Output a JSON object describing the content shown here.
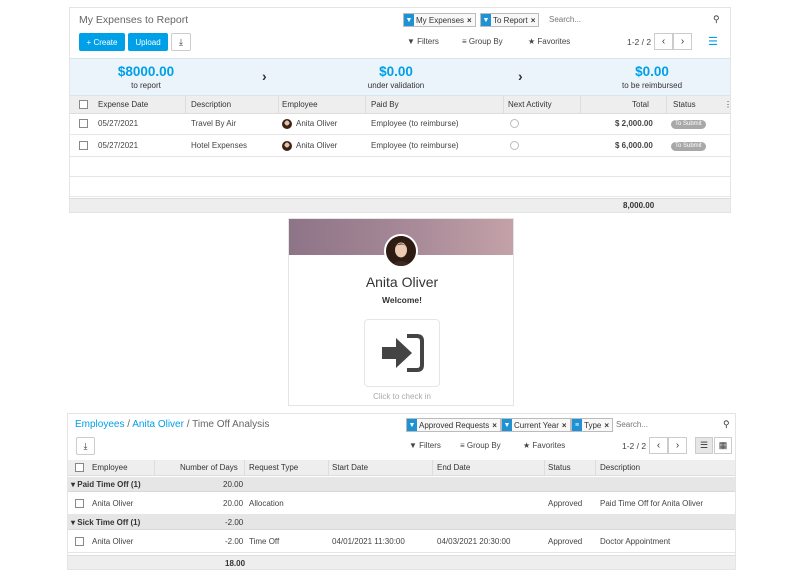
{
  "expenses": {
    "title": "My Expenses to Report",
    "facets": [
      "My Expenses",
      "To Report"
    ],
    "search_placeholder": "Search...",
    "buttons": {
      "create": "+ Create",
      "upload": "Upload"
    },
    "filters": "Filters",
    "group_by": "Group By",
    "favorites": "Favorites",
    "pager": "1-2 / 2",
    "summary": [
      {
        "amount": "$8000.00",
        "label": "to report"
      },
      {
        "amount": "$0.00",
        "label": "under validation"
      },
      {
        "amount": "$0.00",
        "label": "to be reimbursed"
      }
    ],
    "columns": [
      "Expense Date",
      "Description",
      "Employee",
      "Paid By",
      "Next Activity",
      "Total",
      "Status"
    ],
    "rows": [
      {
        "date": "05/27/2021",
        "description": "Travel By Air",
        "employee": "Anita Oliver",
        "paid_by": "Employee (to reimburse)",
        "total": "$ 2,000.00",
        "status": "To Submit"
      },
      {
        "date": "05/27/2021",
        "description": "Hotel Expenses",
        "employee": "Anita Oliver",
        "paid_by": "Employee (to reimburse)",
        "total": "$ 6,000.00",
        "status": "To Submit"
      }
    ],
    "footer_total": "8,000.00"
  },
  "attendance": {
    "name": "Anita Oliver",
    "welcome": "Welcome!",
    "hint": "Click to check in"
  },
  "timeoff": {
    "breadcrumb": [
      "Employees",
      "Anita Oliver",
      "Time Off Analysis"
    ],
    "facets": [
      "Approved Requests",
      "Current Year",
      "Type"
    ],
    "search_placeholder": "Search...",
    "filters": "Filters",
    "group_by": "Group By",
    "favorites": "Favorites",
    "pager": "1-2 / 2",
    "columns": [
      "Employee",
      "Number of Days",
      "Request Type",
      "Start Date",
      "End Date",
      "Status",
      "Description"
    ],
    "groups": [
      {
        "label": "Paid Time Off (1)",
        "days": "20.00",
        "rows": [
          {
            "employee": "Anita Oliver",
            "days": "20.00",
            "type": "Allocation",
            "start": "",
            "end": "",
            "status": "Approved",
            "description": "Paid Time Off for Anita Oliver"
          }
        ]
      },
      {
        "label": "Sick Time Off (1)",
        "days": "-2.00",
        "rows": [
          {
            "employee": "Anita Oliver",
            "days": "-2.00",
            "type": "Time Off",
            "start": "04/01/2021 11:30:00",
            "end": "04/03/2021 20:30:00",
            "status": "Approved",
            "description": "Doctor Appointment"
          }
        ]
      }
    ],
    "footer_total": "18.00"
  }
}
